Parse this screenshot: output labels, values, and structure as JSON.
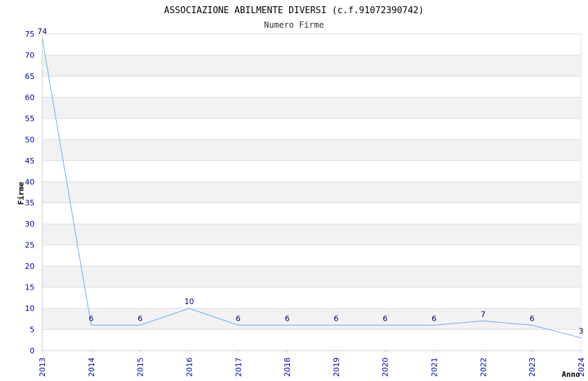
{
  "chart_data": {
    "type": "line",
    "title": "ASSOCIAZIONE ABILMENTE DIVERSI (c.f.91072390742)",
    "subtitle": "Numero Firme",
    "xlabel": "Anno",
    "ylabel": "Firme",
    "ylim": [
      0,
      75
    ],
    "yticks": [
      "0",
      "5",
      "10",
      "15",
      "20",
      "25",
      "30",
      "35",
      "40",
      "45",
      "50",
      "55",
      "60",
      "65",
      "70",
      "75"
    ],
    "x": [
      "2013",
      "2014",
      "2015",
      "2016",
      "2017",
      "2018",
      "2019",
      "2020",
      "2021",
      "2022",
      "2023",
      "2024"
    ],
    "series": [
      {
        "values": [
          74,
          6,
          6,
          10,
          6,
          6,
          6,
          6,
          6,
          7,
          6,
          3
        ]
      }
    ],
    "data_labels": [
      "74",
      "6",
      "6",
      "10",
      "6",
      "6",
      "6",
      "6",
      "6",
      "7",
      "6",
      "3"
    ],
    "grid": true,
    "colors": {
      "line": "#6aaaf0",
      "tick_text": "#0000aa",
      "label_text": "#000066",
      "band_shade": "#f2f2f2",
      "grid_line": "#dddddd",
      "title_text": "#000000"
    }
  }
}
